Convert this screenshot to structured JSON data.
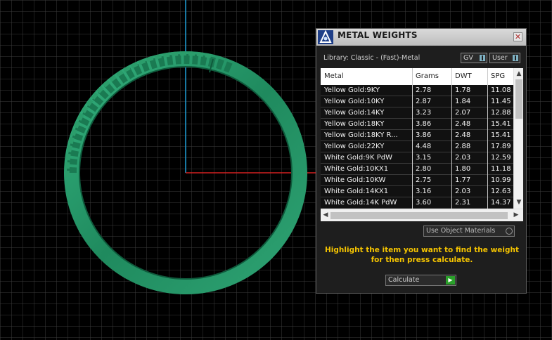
{
  "panel": {
    "title": "METAL WEIGHTS",
    "close_glyph": "✕",
    "library_label": "Library: Classic - (Fast)-Metal",
    "gv_label": "GV",
    "user_label": "User",
    "use_object_materials": "Use Object Materials",
    "hint": "Highlight the item you want to find the weight for then press calculate.",
    "calculate_label": "Calculate"
  },
  "table": {
    "headers": [
      "Metal",
      "Grams",
      "DWT",
      "SPG"
    ],
    "rows": [
      [
        "Yellow Gold:9KY",
        "2.78",
        "1.78",
        "11.08"
      ],
      [
        "Yellow Gold:10KY",
        "2.87",
        "1.84",
        "11.45"
      ],
      [
        "Yellow Gold:14KY",
        "3.23",
        "2.07",
        "12.88"
      ],
      [
        "Yellow Gold:18KY",
        "3.86",
        "2.48",
        "15.41"
      ],
      [
        "Yellow Gold:18KY R...",
        "3.86",
        "2.48",
        "15.41"
      ],
      [
        "Yellow Gold:22KY",
        "4.48",
        "2.88",
        "17.89"
      ],
      [
        "White Gold:9K PdW",
        "3.15",
        "2.03",
        "12.59"
      ],
      [
        "White Gold:10KX1",
        "2.80",
        "1.80",
        "11.18"
      ],
      [
        "White Gold:10KW",
        "2.75",
        "1.77",
        "10.99"
      ],
      [
        "White Gold:14KX1",
        "3.16",
        "2.03",
        "12.63"
      ],
      [
        "White Gold:14K PdW",
        "3.60",
        "2.31",
        "14.37"
      ]
    ]
  },
  "icons": {
    "logo": "app-logo-icon",
    "close": "close-icon",
    "scroll_up": "chevron-up-icon",
    "scroll_down": "chevron-down-icon",
    "play": "play-icon"
  },
  "colors": {
    "ring": "#2a9c6e",
    "hint_text": "#f5c400",
    "grid": "#3a3a3a",
    "x_axis": "#d22020",
    "y_axis": "#1fa0d8"
  }
}
